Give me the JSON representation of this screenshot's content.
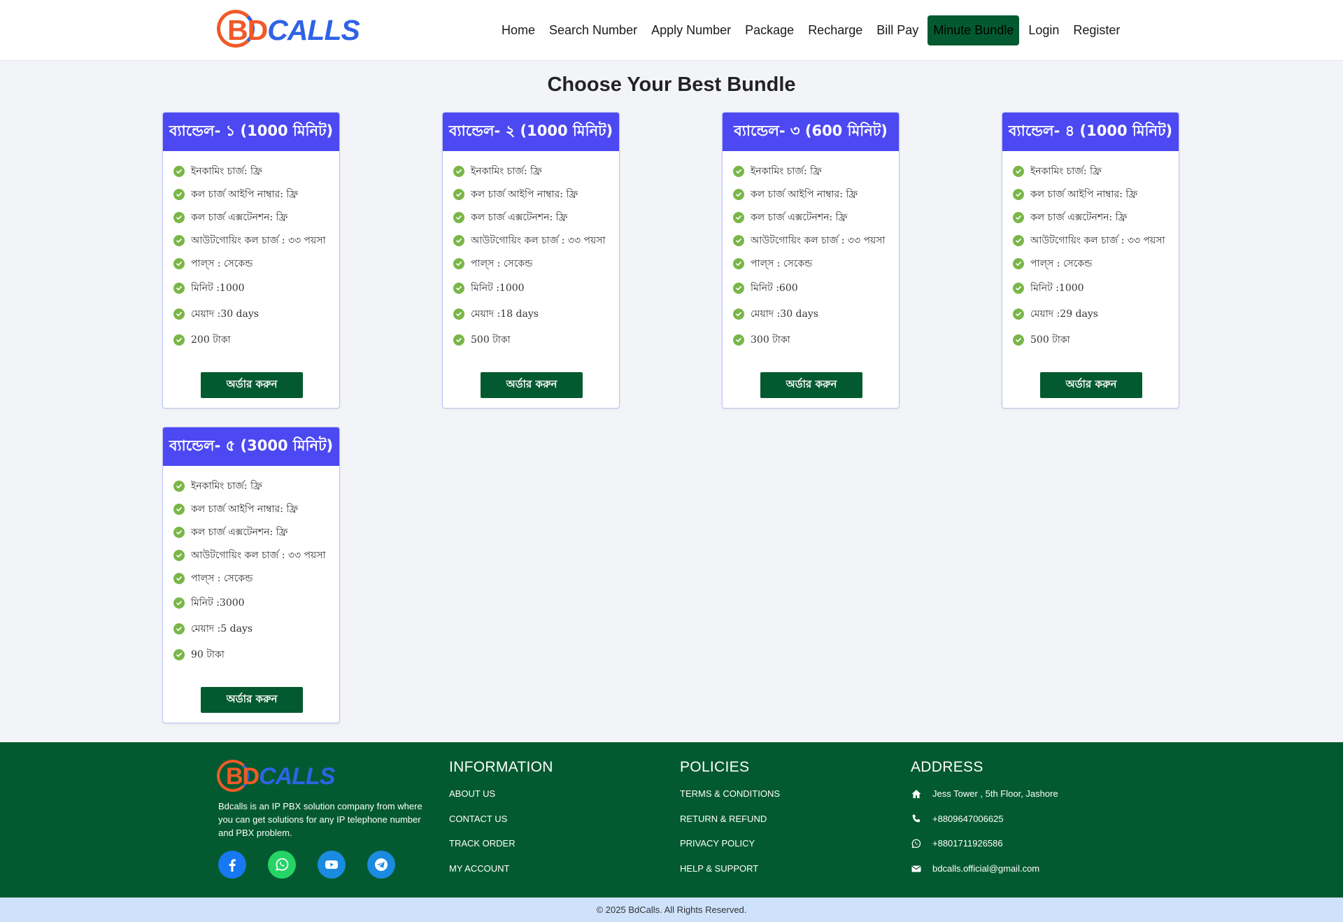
{
  "header": {
    "logo_bd": "BD",
    "logo_calls": "CALLS",
    "nav": [
      {
        "label": "Home"
      },
      {
        "label": "Search Number"
      },
      {
        "label": "Apply Number"
      },
      {
        "label": "Package"
      },
      {
        "label": "Recharge"
      },
      {
        "label": "Bill Pay"
      },
      {
        "label": "Minute Bundle",
        "active": true
      },
      {
        "label": "Login"
      },
      {
        "label": "Register"
      }
    ]
  },
  "main": {
    "title": "Choose Your Best Bundle",
    "order_label": "অর্ডার করুন",
    "bundles": [
      {
        "title": "ব্যান্ডেল- ১ (1000 মিনিট)",
        "features": [
          "ইনকামিং চার্জ: ফ্রি",
          "কল চার্জ আইপি নাম্বার: ফ্রি",
          "কল চার্জ এক্সটেনশন: ফ্রি",
          "আউটগোয়িং কল চার্জ : ৩৩ পয়সা",
          "পাল্স : সেকেন্ড"
        ],
        "minutes": "মিনিট :1000",
        "validity": "মেয়াদ :30 days",
        "price": "200 টাকা"
      },
      {
        "title": "ব্যান্ডেল- ২ (1000 মিনিট)",
        "features": [
          "ইনকামিং চার্জ: ফ্রি",
          "কল চার্জ আইপি নাম্বার: ফ্রি",
          "কল চার্জ এক্সটেনশন: ফ্রি",
          "আউটগোয়িং কল চার্জ : ৩৩ পয়সা",
          "পাল্স : সেকেন্ড"
        ],
        "minutes": "মিনিট :1000",
        "validity": "মেয়াদ :18 days",
        "price": "500 টাকা"
      },
      {
        "title": "ব্যান্ডেল- ৩ (600 মিনিট)",
        "features": [
          "ইনকামিং চার্জ: ফ্রি",
          "কল চার্জ আইপি নাম্বার: ফ্রি",
          "কল চার্জ এক্সটেনশন: ফ্রি",
          "আউটগোয়িং কল চার্জ : ৩৩ পয়সা",
          "পাল্স : সেকেন্ড"
        ],
        "minutes": "মিনিট :600",
        "validity": "মেয়াদ :30 days",
        "price": "300 টাকা"
      },
      {
        "title": "ব্যান্ডেল- ৪ (1000 মিনিট)",
        "features": [
          "ইনকামিং চার্জ: ফ্রি",
          "কল চার্জ আইপি নাম্বার: ফ্রি",
          "কল চার্জ এক্সটেনশন: ফ্রি",
          "আউটগোয়িং কল চার্জ : ৩৩ পয়সা",
          "পাল্স : সেকেন্ড"
        ],
        "minutes": "মিনিট :1000",
        "validity": "মেয়াদ :29 days",
        "price": "500 টাকা"
      },
      {
        "title": "ব্যান্ডেল- ৫ (3000 মিনিট)",
        "features": [
          "ইনকামিং চার্জ: ফ্রি",
          "কল চার্জ আইপি নাম্বার: ফ্রি",
          "কল চার্জ এক্সটেনশন: ফ্রি",
          "আউটগোয়িং কল চার্জ : ৩৩ পয়সা",
          "পাল্স : সেকেন্ড"
        ],
        "minutes": "মিনিট :3000",
        "validity": "মেয়াদ :5 days",
        "price": "90 টাকা"
      }
    ]
  },
  "footer": {
    "about": "Bdcalls is an IP PBX solution company from where you can get solutions for any IP telephone number and PBX problem.",
    "socials": [
      "facebook-icon",
      "whatsapp-icon",
      "youtube-icon",
      "telegram-icon"
    ],
    "information": {
      "heading": "INFORMATION",
      "links": [
        "ABOUT US",
        "CONTACT US",
        "TRACK ORDER",
        "MY ACCOUNT"
      ]
    },
    "policies": {
      "heading": "POLICIES",
      "links": [
        "TERMS & CONDITIONS",
        "RETURN & REFUND",
        "PRIVACY POLICY",
        "HELP & SUPPORT"
      ]
    },
    "address": {
      "heading": "ADDRESS",
      "location": "Jess Tower , 5th Floor, Jashore",
      "phone": "+8809647006625",
      "whatsapp": "+8801711926586",
      "email": "bdcalls.official@gmail.com"
    },
    "copyright": "© 2025 BdCalls. All Rights Reserved."
  },
  "colors": {
    "brand_green": "#045a30",
    "card_header": "#4c48f2",
    "check_green": "#7ab648",
    "logo_orange": "#f05a28",
    "logo_blue": "#2f63e6"
  }
}
